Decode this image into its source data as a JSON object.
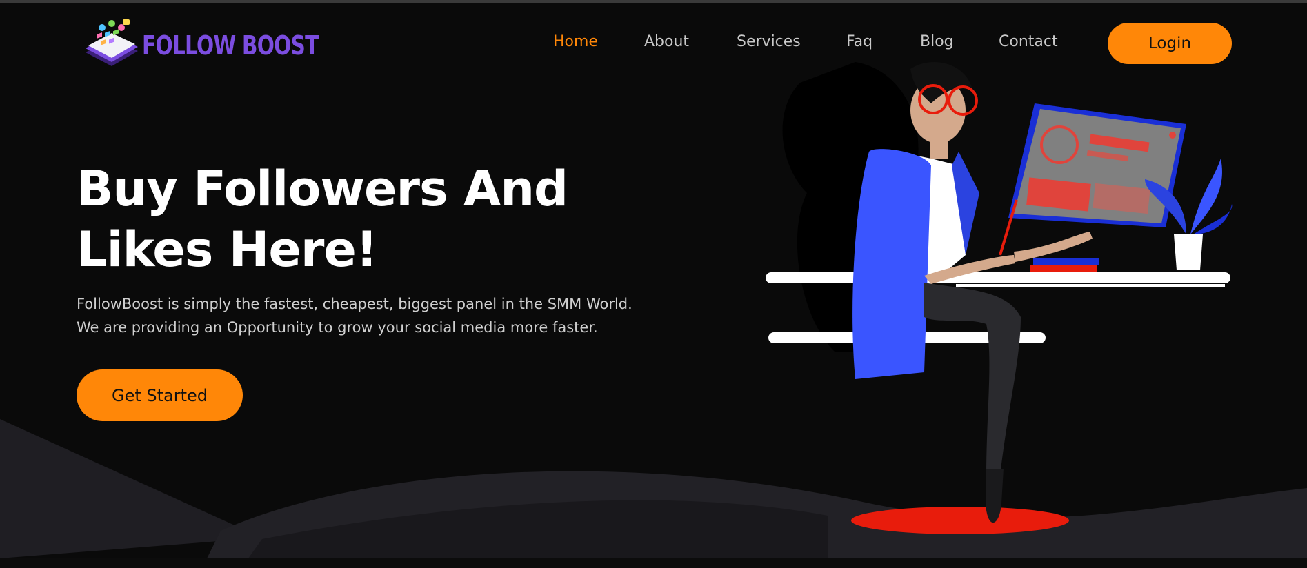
{
  "brand": {
    "name": "FOLLOW BOOST",
    "color": "#7b4de0"
  },
  "nav": {
    "items": [
      {
        "label": "Home",
        "active": true
      },
      {
        "label": "About",
        "active": false
      },
      {
        "label": "Services",
        "active": false
      },
      {
        "label": "Faq",
        "active": false
      },
      {
        "label": "Blog",
        "active": false
      },
      {
        "label": "Contact",
        "active": false
      }
    ],
    "login_label": "Login"
  },
  "hero": {
    "title_line1": "Buy Followers And",
    "title_line2": "Likes Here!",
    "desc_line1": "FollowBoost is simply the fastest, cheapest, biggest panel in the SMM World.",
    "desc_line2": "We are providing an Opportunity to grow your social media more faster.",
    "cta_label": "Get Started"
  },
  "colors": {
    "accent": "#ff8708",
    "background": "#0a0a0a",
    "wave": "#222126"
  },
  "icons": {
    "logo": "phone-apps-logo-icon",
    "illustration": "woman-at-desk-illustration"
  }
}
